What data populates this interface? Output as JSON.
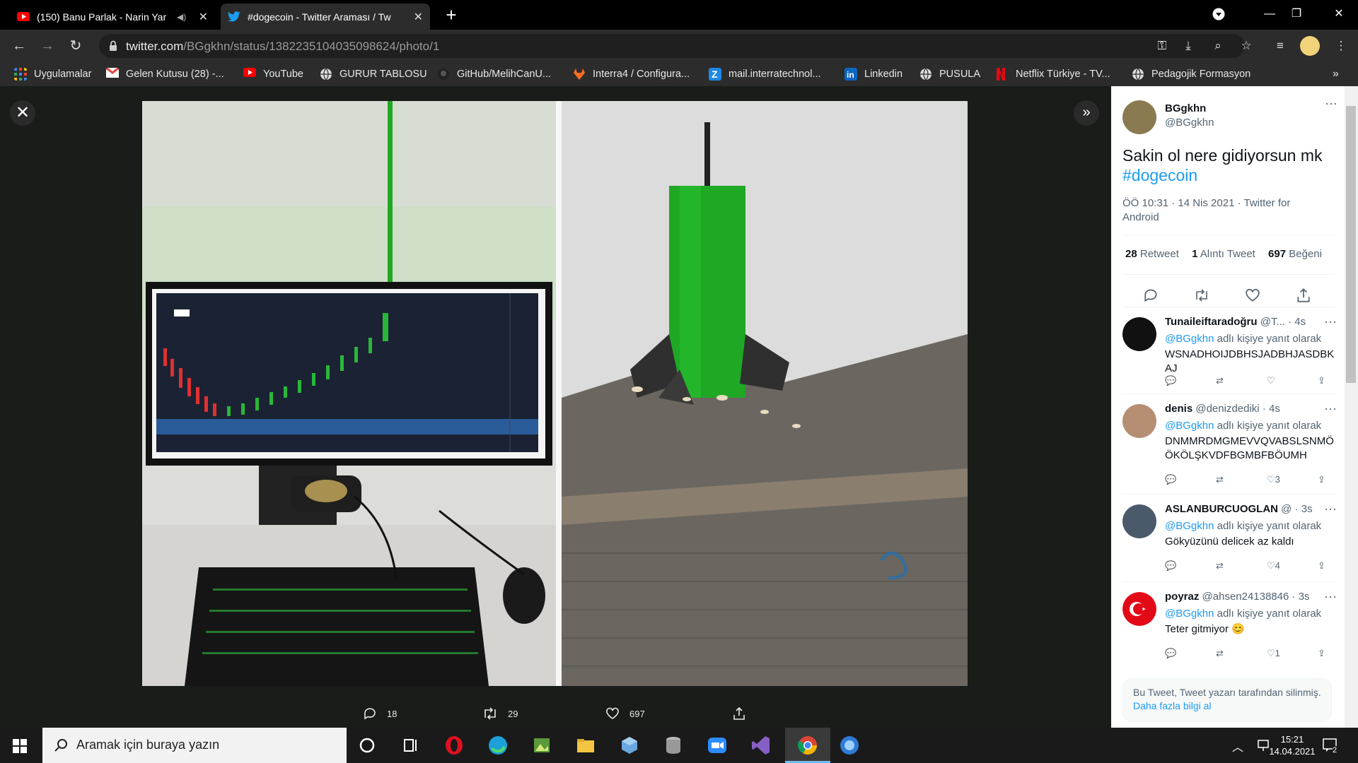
{
  "browser": {
    "tabs": [
      {
        "title": "(150) Banu Parlak - Narin Yar",
        "favicon": "youtube-icon",
        "active": false
      },
      {
        "title": "#dogecoin - Twitter Araması / Tw",
        "favicon": "twitter-icon",
        "active": true
      }
    ],
    "url_domain": "twitter.com",
    "url_path": "/BGgkhn/status/1382235104035098624/photo/1",
    "bookmarks": [
      {
        "label": "Uygulamalar",
        "icon": "apps-grid-icon"
      },
      {
        "label": "Gelen Kutusu (28) -...",
        "icon": "gmail-icon"
      },
      {
        "label": "YouTube",
        "icon": "youtube-icon"
      },
      {
        "label": "GURUR TABLOSU",
        "icon": "globe-icon"
      },
      {
        "label": "GitHub/MelihCanU...",
        "icon": "github-icon"
      },
      {
        "label": "Interra4 / Configura...",
        "icon": "gitlab-icon"
      },
      {
        "label": "mail.interratechnol...",
        "icon": "zimbra-icon"
      },
      {
        "label": "Linkedin",
        "icon": "linkedin-icon"
      },
      {
        "label": "PUSULA",
        "icon": "globe-icon"
      },
      {
        "label": "Netflix Türkiye - TV...",
        "icon": "netflix-icon"
      },
      {
        "label": "Pedagojik Formasyon",
        "icon": "globe-icon"
      }
    ]
  },
  "photo_actions": {
    "replies": "18",
    "retweets": "29",
    "likes": "697"
  },
  "tweet": {
    "name": "BGgkhn",
    "handle": "@BGgkhn",
    "text": "Sakin ol nere gidiyorsun mk",
    "hashtag": "#dogecoin",
    "meta": "ÖÖ 10:31 · 14 Nis 2021 · Twitter for Android",
    "retweets_count": "28",
    "retweets_label": "Retweet",
    "quotes_count": "1",
    "quotes_label": "Alıntı Tweet",
    "likes_count": "697",
    "likes_label": "Beğeni"
  },
  "replies": [
    {
      "name": "Tunaileiftaradoğru",
      "handle": "@T...",
      "time": "· 4s",
      "reply_prefix": "@BGgkhn",
      "reply_suffix": " adlı kişiye yanıt olarak",
      "text": "WSNADHOIJDBHSJADBHJASDBKAJ",
      "likes": ""
    },
    {
      "name": "denis",
      "handle": "@denizdediki",
      "time": "· 4s",
      "reply_prefix": "@BGgkhn",
      "reply_suffix": " adlı kişiye yanıt olarak",
      "text": "DNMMRDMGMEVVQVABSLSNMÖ ÖKÖLŞKVDFBGMBFBÖUMH",
      "likes": "3"
    },
    {
      "name": "ASLANBURCUOGLAN",
      "handle": "@",
      "time": "· 3s",
      "reply_prefix": "@BGgkhn",
      "reply_suffix": " adlı kişiye yanıt olarak",
      "text": "Gökyüzünü delicek az kaldı",
      "likes": "4"
    },
    {
      "name": "poyraz",
      "handle": "@ahsen24138846",
      "time": "· 3s",
      "reply_prefix": "@BGgkhn",
      "reply_suffix": " adlı kişiye yanıt olarak",
      "text": "Teter gitmiyor 😊",
      "likes": "1"
    }
  ],
  "deleted_notice": {
    "text": "Bu Tweet, Tweet yazarı tarafından silinmiş.",
    "link": "Daha fazla bilgi al"
  },
  "taskbar": {
    "search_placeholder": "Aramak için buraya yazın",
    "time": "15:21",
    "date": "14.04.2021",
    "notification_count": "2"
  },
  "colors": {
    "twitter_blue": "#1d9bf0",
    "chart_green": "#1fa824"
  }
}
